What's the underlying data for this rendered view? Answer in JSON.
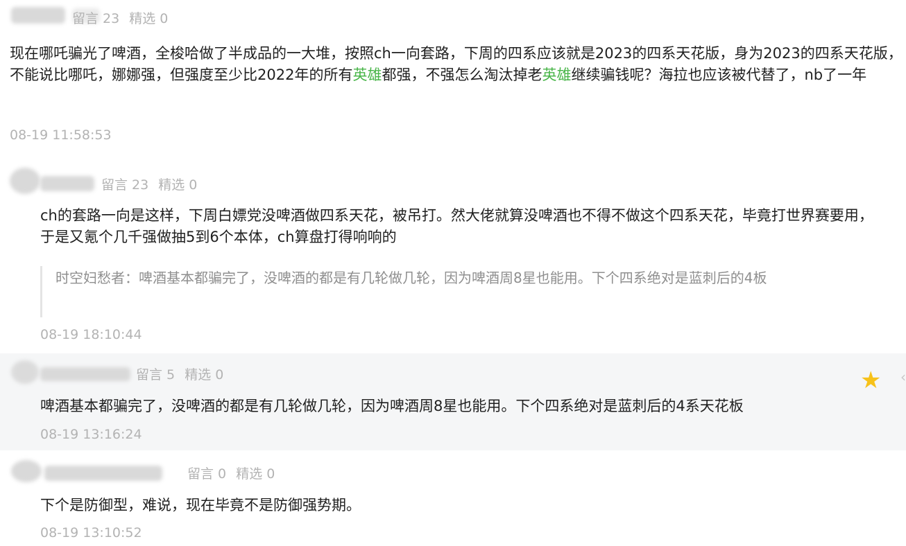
{
  "comments": [
    {
      "meta": {
        "messages": "留言 23",
        "picks": "精选 0"
      },
      "content_parts": [
        "现在哪吒骗光了啤酒，全梭哈做了半成品的一大堆，按照ch一向套路，下周的四系应该就是2023的四系天花版，身为2023的四系天花版，不能说比哪吒，娜娜强，但强度至少比2022年的所有",
        "英雄",
        "都强，不强怎么淘汰掉老",
        "英雄",
        "继续骗钱呢？海拉也应该被代替了，nb了一年"
      ],
      "time": "08-19 11:58:53"
    },
    {
      "meta": {
        "messages": "留言 23",
        "picks": "精选 0"
      },
      "content": "ch的套路一向是这样，下周白嫖党没啤酒做四系天花，被吊打。然大佬就算没啤酒也不得不做这个四系天花，毕竟打世界赛要用，于是又氪个几千强做抽5到6个本体，ch算盘打得响响的",
      "quote": "时空妇愁者：啤酒基本都骗完了，没啤酒的都是有几轮做几轮，因为啤酒周8星也能用。下个四系绝对是蓝刺后的4板",
      "time": "08-19 18:10:44"
    },
    {
      "meta": {
        "messages": "留言 5",
        "picks": "精选 0"
      },
      "content": "啤酒基本都骗完了，没啤酒的都是有几轮做几轮，因为啤酒周8星也能用。下个四系绝对是蓝刺后的4系天花板",
      "time": "08-19 13:16:24"
    },
    {
      "meta": {
        "messages": "留言 0",
        "picks": "精选 0"
      },
      "content": "下个是防御型，难说，现在毕竟不是防御强势期。",
      "time": "08-19 13:10:52"
    }
  ],
  "icons": {
    "star": "star-icon",
    "chevron": "chevron-left-icon"
  },
  "colors": {
    "highlight_green": "#48b548",
    "meta_gray": "#b3b3b3",
    "star_yellow": "#f7c21a",
    "row_highlight_bg": "#f5f6f7"
  }
}
